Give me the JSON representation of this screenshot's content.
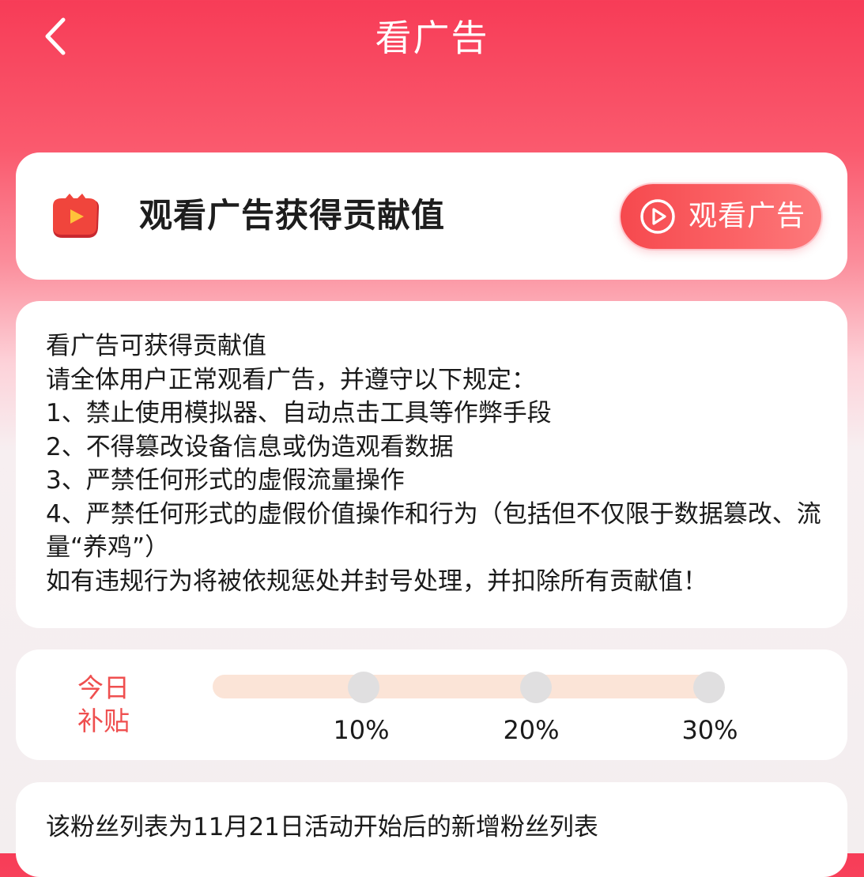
{
  "header": {
    "title": "看广告"
  },
  "watch_card": {
    "title": "观看广告获得贡献值",
    "button_label": "观看广告"
  },
  "rules_card": {
    "lines": [
      "看广告可获得贡献值",
      "请全体用户正常观看广告，并遵守以下规定：",
      "1、禁止使用模拟器、自动点击工具等作弊手段",
      "2、不得篡改设备信息或伪造观看数据",
      "3、严禁任何形式的虚假流量操作",
      "4、严禁任何形式的虚假价值操作和行为（包括但不仅限于数据篡改、流量“养鸡”）",
      "如有违规行为将被依规惩处并封号处理，并扣除所有贡献值！"
    ]
  },
  "subsidy_card": {
    "label_line1": "今日",
    "label_line2": "补贴",
    "progress_percent": 0,
    "tiers": [
      {
        "label": "10%",
        "value": 10
      },
      {
        "label": "20%",
        "value": 20
      },
      {
        "label": "30%",
        "value": 30
      }
    ]
  },
  "fans_card": {
    "text": "该粉丝列表为11月21日活动开始后的新增粉丝列表"
  },
  "colors": {
    "brand_red": "#f73c57",
    "button_red": "#f6494e",
    "subsidy_label": "#ef4f4f",
    "progress_track": "#fbe4d7",
    "progress_node": "#e0dfe0"
  },
  "icons": {
    "back": "chevron-left-icon",
    "ad": "video-ad-icon",
    "play": "play-circle-icon"
  }
}
